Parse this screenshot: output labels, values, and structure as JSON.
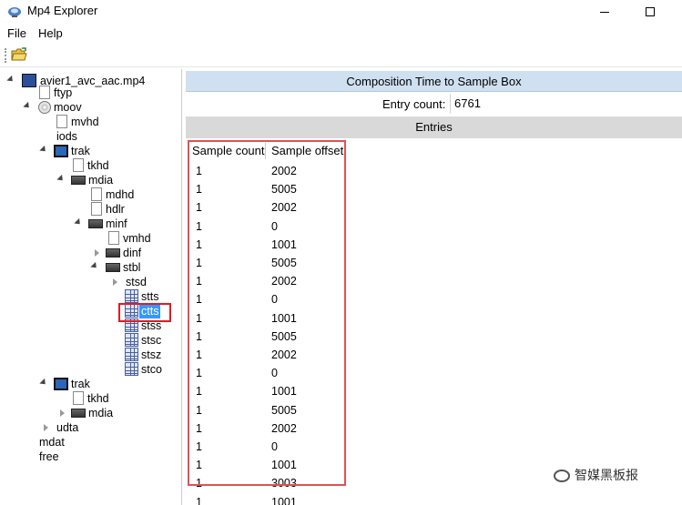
{
  "window": {
    "title": "Mp4 Explorer"
  },
  "menu": {
    "file": "File",
    "help": "Help"
  },
  "tree": {
    "nodes": [
      {
        "label": "avier1_avc_aac.mp4",
        "icon": "mp4-file-icon"
      },
      {
        "label": "ftyp",
        "icon": "document-icon"
      },
      {
        "label": "moov",
        "icon": "disc-icon"
      },
      {
        "label": "mvhd",
        "icon": "document-icon"
      },
      {
        "label": "iods",
        "icon": "none"
      },
      {
        "label": "trak",
        "icon": "film-icon"
      },
      {
        "label": "tkhd",
        "icon": "document-icon"
      },
      {
        "label": "mdia",
        "icon": "folder-icon"
      },
      {
        "label": "mdhd",
        "icon": "document-icon"
      },
      {
        "label": "hdlr",
        "icon": "document-icon"
      },
      {
        "label": "minf",
        "icon": "folder-icon"
      },
      {
        "label": "vmhd",
        "icon": "document-icon"
      },
      {
        "label": "dinf",
        "icon": "folder-icon"
      },
      {
        "label": "stbl",
        "icon": "folder-icon"
      },
      {
        "label": "stsd",
        "icon": "none"
      },
      {
        "label": "stts",
        "icon": "table-icon"
      },
      {
        "label": "ctts",
        "icon": "table-icon",
        "selected": true
      },
      {
        "label": "stss",
        "icon": "table-icon"
      },
      {
        "label": "stsc",
        "icon": "table-icon"
      },
      {
        "label": "stsz",
        "icon": "table-icon"
      },
      {
        "label": "stco",
        "icon": "table-icon"
      },
      {
        "label": "trak",
        "icon": "film-icon"
      },
      {
        "label": "tkhd",
        "icon": "document-icon"
      },
      {
        "label": "mdia",
        "icon": "folder-icon"
      },
      {
        "label": "udta",
        "icon": "none"
      },
      {
        "label": "mdat",
        "icon": "none"
      },
      {
        "label": "free",
        "icon": "none"
      }
    ]
  },
  "box": {
    "title": "Composition Time to Sample Box",
    "entry_count_label": "Entry count:",
    "entry_count_value": "6761",
    "entries_label": "Entries"
  },
  "table": {
    "headers": [
      "Sample count",
      "Sample offset"
    ],
    "rows": [
      [
        "1",
        "2002"
      ],
      [
        "1",
        "5005"
      ],
      [
        "1",
        "2002"
      ],
      [
        "1",
        "0"
      ],
      [
        "1",
        "1001"
      ],
      [
        "1",
        "5005"
      ],
      [
        "1",
        "2002"
      ],
      [
        "1",
        "0"
      ],
      [
        "1",
        "1001"
      ],
      [
        "1",
        "5005"
      ],
      [
        "1",
        "2002"
      ],
      [
        "1",
        "0"
      ],
      [
        "1",
        "1001"
      ],
      [
        "1",
        "5005"
      ],
      [
        "1",
        "2002"
      ],
      [
        "1",
        "0"
      ],
      [
        "1",
        "1001"
      ],
      [
        "1",
        "3003"
      ],
      [
        "1",
        "1001"
      ]
    ]
  },
  "watermark": {
    "text": "智媒黑板报"
  },
  "colors": {
    "header_blue": "#cfe0f0",
    "selection": "#3399ff",
    "highlight_red": "#e01b24"
  }
}
